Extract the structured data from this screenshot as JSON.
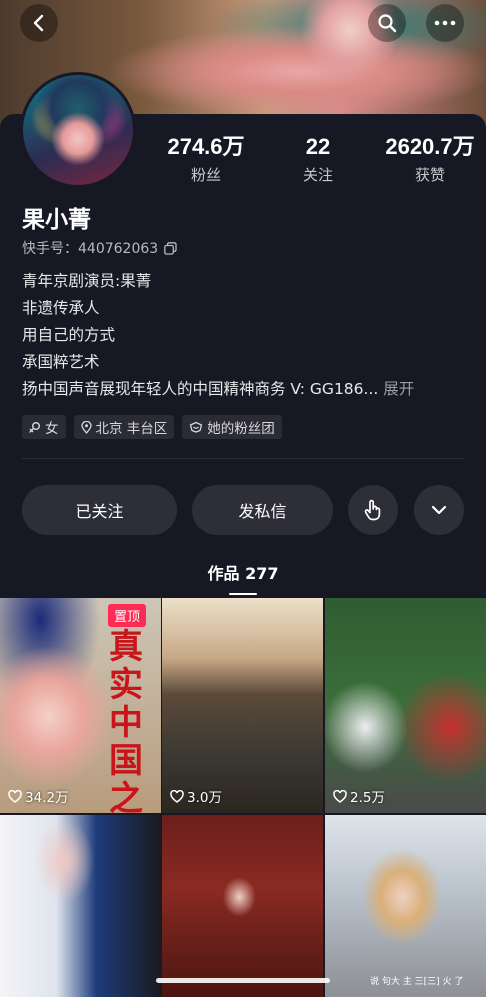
{
  "header": {
    "back_icon": "chevron-left-icon",
    "search_icon": "search-icon",
    "more_icon": "more-horizontal-icon"
  },
  "profile": {
    "avatar_icon": "avatar",
    "stats": [
      {
        "value": "274.6万",
        "label": "粉丝"
      },
      {
        "value": "22",
        "label": "关注"
      },
      {
        "value": "2620.7万",
        "label": "获赞"
      }
    ],
    "name": "果小菁",
    "uid_label": "快手号：440762063",
    "bio_lines": [
      "青年京剧演员:果菁",
      "非遗传承人",
      "用自己的方式",
      "承国粹艺术"
    ],
    "bio_last": "扬中国声音展现年轻人的中国精神商务 V: GG186...",
    "bio_expand": "展开",
    "tags": [
      {
        "icon": "female-icon",
        "label": "女"
      },
      {
        "icon": "location-pin-icon",
        "label": "北京 丰台区"
      },
      {
        "icon": "fan-group-icon",
        "label": "她的粉丝团"
      }
    ]
  },
  "actions": {
    "follow_label": "已关注",
    "message_label": "发私信",
    "share_icon": "hand-pointer-icon",
    "dropdown_icon": "chevron-down-icon"
  },
  "tabs": {
    "works_label": "作品 277"
  },
  "grid": [
    {
      "likes": "34.2万",
      "pinned_label": "置顶",
      "poster_text": "真实中国之美"
    },
    {
      "likes": "3.0万"
    },
    {
      "likes": "2.5万"
    },
    {
      "likes": ""
    },
    {
      "likes": ""
    },
    {
      "likes": "",
      "subtitle": "说 句大 主 三[三] 火 了"
    }
  ],
  "colors": {
    "background": "#161823",
    "accent": "#fe2c55",
    "button_bg": "#2d2e38"
  }
}
